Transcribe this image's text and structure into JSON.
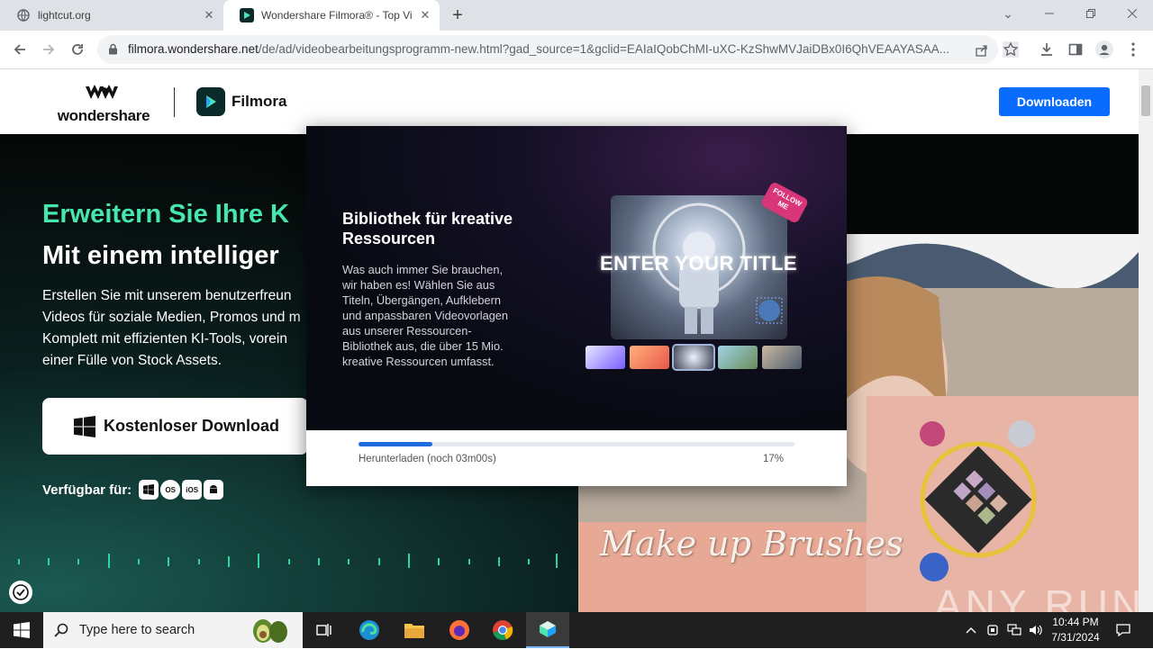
{
  "browser": {
    "tabs": [
      {
        "title": "lightcut.org",
        "active": false
      },
      {
        "title": "Wondershare Filmora® - Top Vi",
        "active": true
      }
    ],
    "new_tab_label": "+",
    "url_host": "filmora.wondershare.net",
    "url_path": "/de/ad/videobearbeitungsprogramm-new.html?gad_source=1&gclid=EAIaIQobChMI-uXC-KzShwMVJaiDBx0I6QhVEAAYASAA..."
  },
  "header": {
    "brand_word": "wondershare",
    "product_name": "Filmora",
    "download_button": "Downloaden"
  },
  "hero": {
    "headline_green": "Erweitern Sie Ihre K",
    "headline_white": "Mit einem intelliger",
    "paragraph_lines": [
      "Erstellen Sie mit unserem benutzerfreun",
      "Videos für soziale Medien, Promos und m",
      "Komplett mit effizienten KI-Tools, vorein",
      "einer Fülle von Stock Assets."
    ],
    "free_download_button": "Kostenloser Download",
    "available_label": "Verfügbar für:",
    "platforms": [
      "Windows",
      "macOS",
      "iOS",
      "Android"
    ],
    "platform_badges": [
      "",
      "OS",
      "iOS",
      ""
    ],
    "photo_caption": "Make up Brushes",
    "watermark": "ANY RUN"
  },
  "installer_dialog": {
    "title": "Bibliothek für kreative Ressourcen",
    "description_lines": [
      "Was auch immer Sie brauchen,",
      "wir haben es! Wählen Sie aus",
      "Titeln, Übergängen, Aufklebern",
      "und anpassbaren Videovorlagen",
      "aus unserer Ressourcen-",
      "Bibliothek aus, die über 15 Mio.",
      "kreative Ressourcen umfasst."
    ],
    "preview_title": "ENTER YOUR TITLE",
    "preview_sticker": "FOLLOW ME",
    "status_text": "Herunterladen (noch 03m00s)",
    "progress_percent_label": "17%",
    "progress_value": 0.17,
    "progress_color": "#1f6be0"
  },
  "taskbar": {
    "search_placeholder": "Type here to search",
    "time": "10:44 PM",
    "date": "7/31/2024"
  },
  "colors": {
    "accent_blue": "#0a6cff",
    "headline_green": "#47e6b0",
    "hero_bg": "#050807"
  }
}
